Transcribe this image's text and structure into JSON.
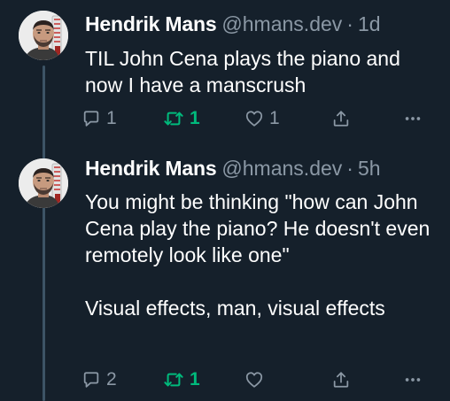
{
  "colors": {
    "background": "#15202b",
    "text": "#ffffff",
    "muted": "#8b98a5",
    "retweet_active": "#00ba7c",
    "thread_line": "#3d5466"
  },
  "tweets": [
    {
      "author": {
        "name": "Hendrik Mans",
        "handle": "@hmans.dev"
      },
      "separator": "·",
      "time": "1d",
      "text": [
        "TIL John Cena plays the piano and now I have a manscrush"
      ],
      "actions": {
        "reply": {
          "icon": "reply-icon",
          "count": "1"
        },
        "retweet": {
          "icon": "retweet-icon",
          "count": "1",
          "active": true
        },
        "like": {
          "icon": "heart-icon",
          "count": "1"
        },
        "share": {
          "icon": "share-icon"
        },
        "more": {
          "icon": "more-icon"
        }
      }
    },
    {
      "author": {
        "name": "Hendrik Mans",
        "handle": "@hmans.dev"
      },
      "separator": "·",
      "time": "5h",
      "text": [
        "You might be thinking \"how can John Cena play the piano? He doesn't even remotely look like one\"",
        "Visual effects, man, visual effects"
      ],
      "actions": {
        "reply": {
          "icon": "reply-icon",
          "count": "2"
        },
        "retweet": {
          "icon": "retweet-icon",
          "count": "1",
          "active": true
        },
        "like": {
          "icon": "heart-icon",
          "count": ""
        },
        "share": {
          "icon": "share-icon"
        },
        "more": {
          "icon": "more-icon"
        }
      }
    }
  ]
}
